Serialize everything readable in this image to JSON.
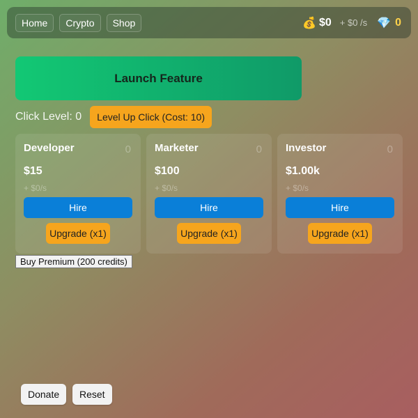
{
  "nav": {
    "items": [
      "Home",
      "Crypto",
      "Shop"
    ]
  },
  "stats": {
    "money_icon": "💰",
    "money": "$0",
    "rate": "+ $0 /s",
    "gem_icon": "💎",
    "gems": "0"
  },
  "launch": {
    "label": "Launch Feature"
  },
  "click": {
    "level_label": "Click Level: 0",
    "level_up_label": "Level Up Click (Cost: 10)"
  },
  "workers": [
    {
      "name": "Developer",
      "count": "0",
      "cost": "$15",
      "income": "+ $0/s",
      "hire_label": "Hire",
      "upgrade_label": "Upgrade (x1)"
    },
    {
      "name": "Marketer",
      "count": "0",
      "cost": "$100",
      "income": "+ $0/s",
      "hire_label": "Hire",
      "upgrade_label": "Upgrade (x1)"
    },
    {
      "name": "Investor",
      "count": "0",
      "cost": "$1.00k",
      "income": "+ $0/s",
      "hire_label": "Hire",
      "upgrade_label": "Upgrade (x1)"
    }
  ],
  "premium": {
    "label": "Buy Premium (200 credits)"
  },
  "footer": {
    "donate_label": "Donate",
    "reset_label": "Reset"
  },
  "colors": {
    "primary": "#0a7fd8",
    "accent": "#f6a51d",
    "launch": "#12c874",
    "gem": "#ffd24a"
  }
}
